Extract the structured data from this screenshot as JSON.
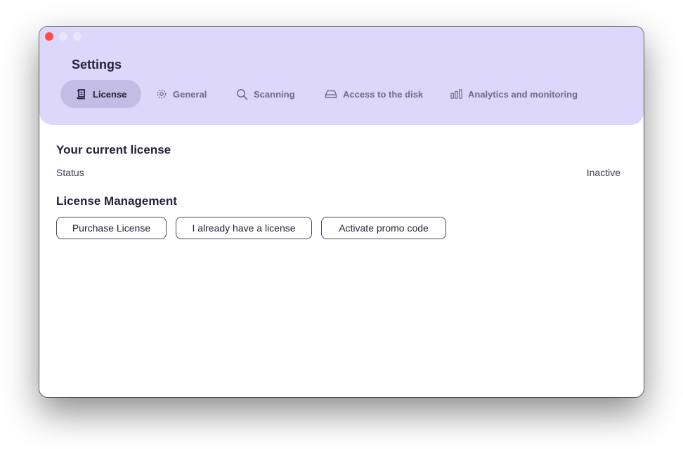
{
  "window": {
    "title": "Settings"
  },
  "tabs": [
    {
      "label": "License",
      "icon": "scroll-icon",
      "active": true
    },
    {
      "label": "General",
      "icon": "gear-icon",
      "active": false
    },
    {
      "label": "Scanning",
      "icon": "search-icon",
      "active": false
    },
    {
      "label": "Access to the disk",
      "icon": "disk-icon",
      "active": false
    },
    {
      "label": "Analytics and monitoring",
      "icon": "bar-chart-icon",
      "active": false
    }
  ],
  "current_license": {
    "heading": "Your current license",
    "status_label": "Status",
    "status_value": "Inactive"
  },
  "management": {
    "heading": "License Management",
    "buttons": {
      "purchase": "Purchase License",
      "have_license": "I already have a license",
      "promo": "Activate promo code"
    }
  },
  "colors": {
    "header_bg": "#ddd8fb",
    "active_tab_bg": "#c3bde6",
    "close_button": "#fc4b4b",
    "text_dark": "#23223a"
  }
}
